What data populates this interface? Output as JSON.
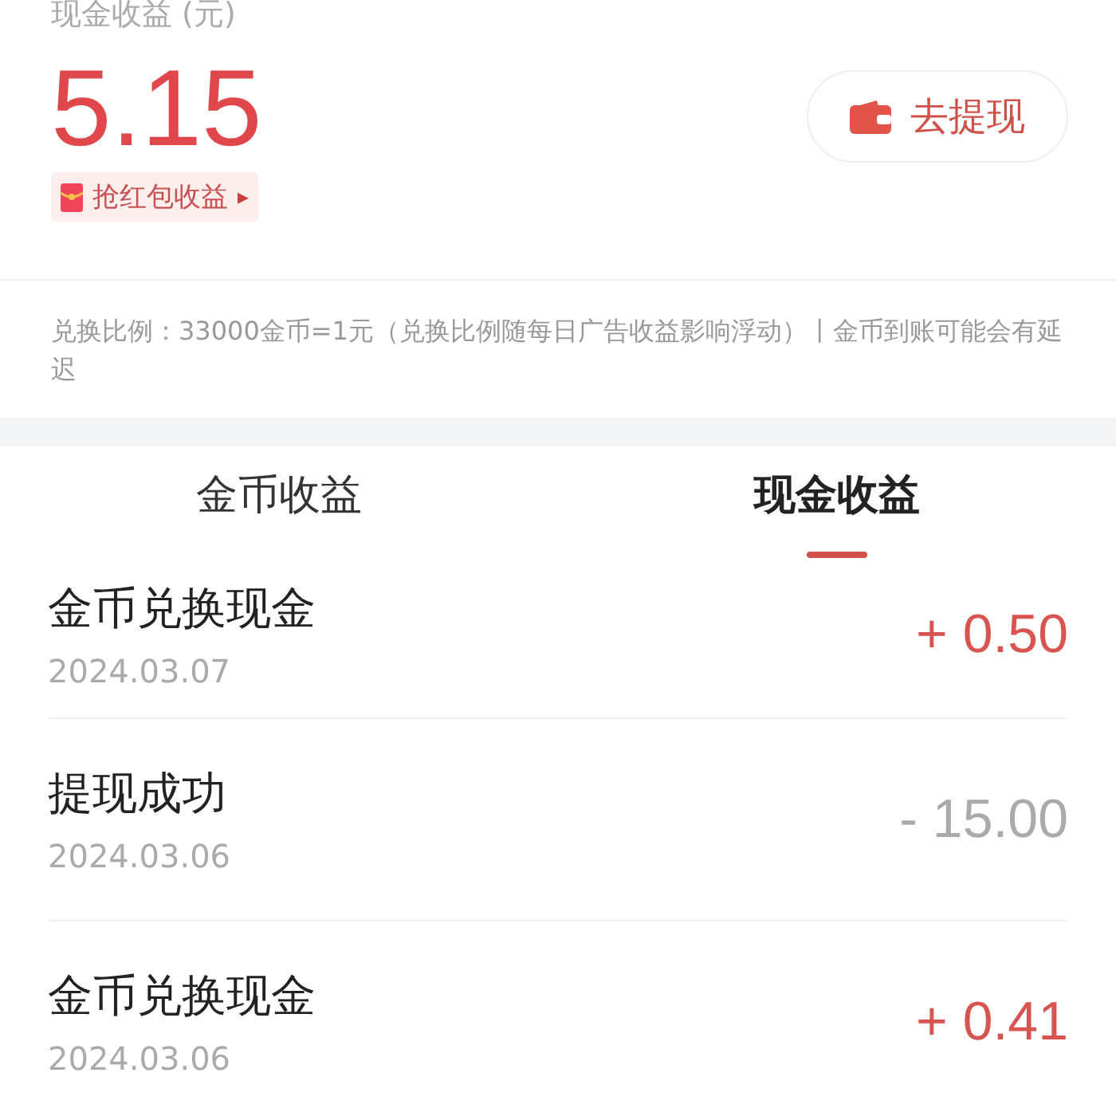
{
  "balance": {
    "label": "现金收益 (元)",
    "amount": "5.15",
    "badge": "抢红包收益",
    "badge_arrow": "▸"
  },
  "withdraw_button": {
    "label": "去提现"
  },
  "note": "兑换比例：33000金币=1元（兑换比例随每日广告收益影响浮动）丨金币到账可能会有延迟",
  "tabs": [
    {
      "label": "金币收益",
      "selected": false
    },
    {
      "label": "现金收益",
      "selected": true
    }
  ],
  "records": [
    {
      "title": "金币兑换现金",
      "date": "2024.03.07",
      "amount": "+ 0.50",
      "kind": "income"
    },
    {
      "title": "提现成功",
      "date": "2024.03.06",
      "amount": "- 15.00",
      "kind": "expense"
    },
    {
      "title": "金币兑换现金",
      "date": "2024.03.06",
      "amount": "+ 0.41",
      "kind": "income"
    }
  ]
}
